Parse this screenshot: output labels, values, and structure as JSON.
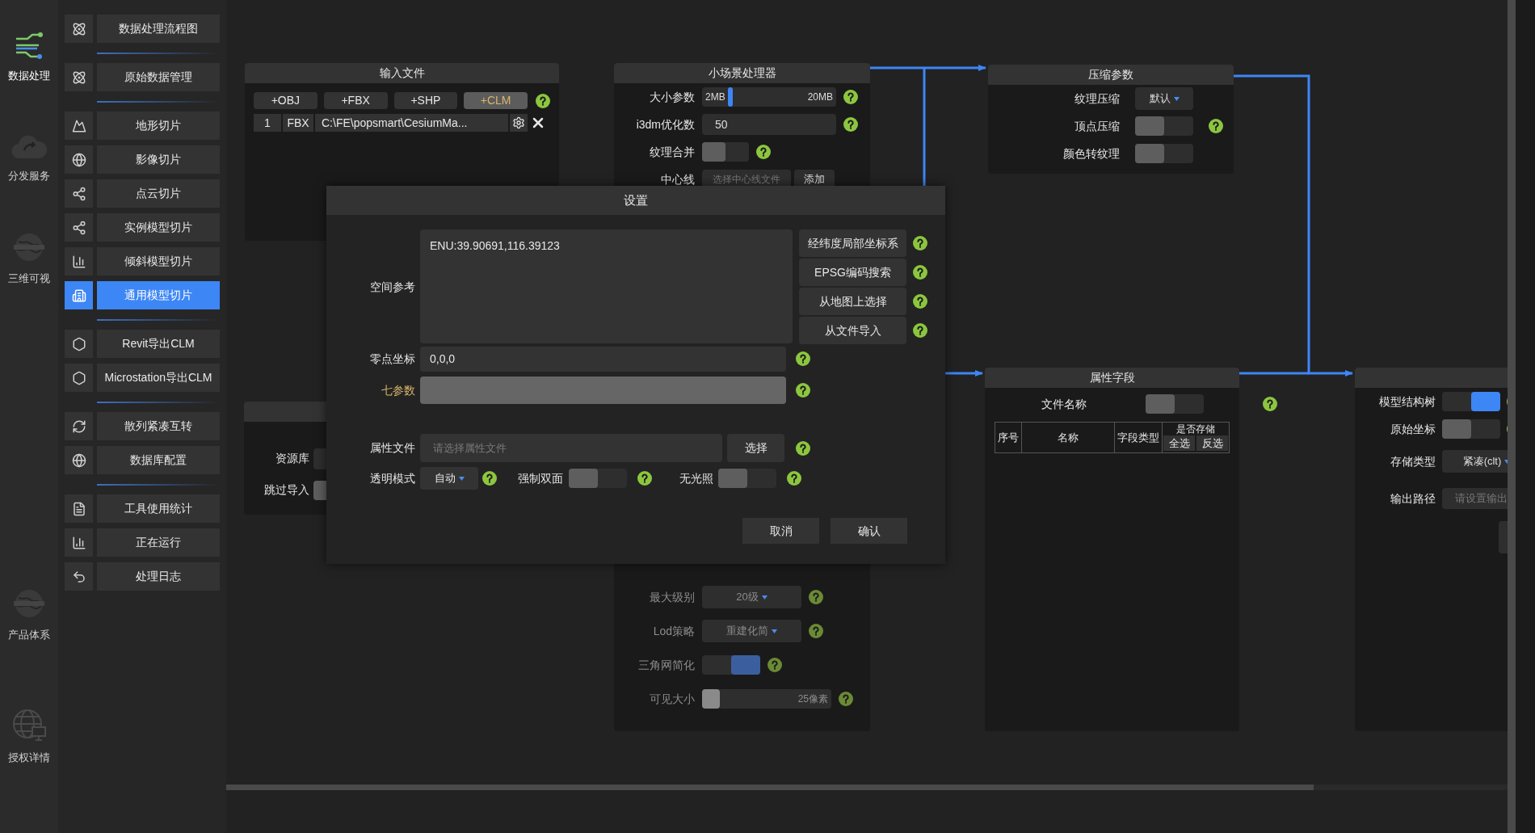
{
  "rail": [
    {
      "label": "数据处理",
      "selected": true
    },
    {
      "label": "分发服务",
      "selected": false
    },
    {
      "label": "三维可视",
      "selected": false
    },
    {
      "label": "产品体系",
      "selected": false
    },
    {
      "label": "授权详情",
      "selected": false
    }
  ],
  "menu": [
    [
      {
        "label": "数据处理流程图",
        "selected": false
      }
    ],
    [
      {
        "label": "原始数据管理",
        "selected": false
      }
    ],
    [
      {
        "label": "地形切片",
        "selected": false
      },
      {
        "label": "影像切片",
        "selected": false
      },
      {
        "label": "点云切片",
        "selected": false
      },
      {
        "label": "实例模型切片",
        "selected": false
      },
      {
        "label": "倾斜模型切片",
        "selected": false
      },
      {
        "label": "通用模型切片",
        "selected": true
      }
    ],
    [
      {
        "label": "Revit导出CLM",
        "selected": false
      },
      {
        "label": "Microstation导出CLM",
        "selected": false
      }
    ],
    [
      {
        "label": "散列紧凑互转",
        "selected": false
      },
      {
        "label": "数据库配置",
        "selected": false
      }
    ],
    [
      {
        "label": "工具使用统计",
        "selected": false
      },
      {
        "label": "正在运行",
        "selected": false
      },
      {
        "label": "处理日志",
        "selected": false
      }
    ]
  ],
  "input_node": {
    "title": "输入文件",
    "file_buttons": [
      {
        "label": "+OBJ",
        "selected": false
      },
      {
        "label": "+FBX",
        "selected": false
      },
      {
        "label": "+SHP",
        "selected": false
      },
      {
        "label": "+CLM",
        "selected": true
      }
    ],
    "files": [
      {
        "index": "1",
        "format": "FBX",
        "path": "C:\\FE\\popsmart\\CesiumMa..."
      }
    ]
  },
  "scene_node": {
    "title": "小场景处理器",
    "upper_rows": [
      {
        "kind": "slider",
        "label": "大小参数",
        "min_label": "2MB",
        "max_label": "20MB",
        "level": 0.2,
        "help": true,
        "disabled": false
      },
      {
        "kind": "input",
        "label": "i3dm优化数",
        "value": "50",
        "help": true,
        "disabled": false
      },
      {
        "kind": "toggle",
        "label": "纹理合并",
        "on": false,
        "help": true,
        "disabled": false
      },
      {
        "kind": "file",
        "label": "中心线",
        "placeholder": "选择中心线文件",
        "button": "添加",
        "help": false,
        "disabled": false
      }
    ],
    "lower_rows": [
      {
        "kind": "dropdown",
        "label": "最大级别",
        "value": "20级",
        "help": true,
        "disabled": true
      },
      {
        "kind": "dropdown",
        "label": "Lod策略",
        "value": "重建化简",
        "help": true,
        "disabled": true
      },
      {
        "kind": "toggle",
        "label": "三角网简化",
        "on": true,
        "help": true,
        "disabled": true
      },
      {
        "kind": "slider",
        "label": "可见大小",
        "max_label": "25像素",
        "level": 0,
        "help": true,
        "disabled": true
      }
    ]
  },
  "compress_node": {
    "title": "压缩参数",
    "rows": [
      {
        "kind": "dropdown",
        "label": "纹理压缩",
        "value": "默认",
        "help": false
      },
      {
        "kind": "toggle",
        "label": "顶点压缩",
        "on": false,
        "help": true
      },
      {
        "kind": "toggle",
        "label": "颜色转纹理",
        "on": false,
        "help": false
      }
    ]
  },
  "resource_node": {
    "rows": [
      {
        "kind": "input",
        "label": "资源库",
        "help": false
      },
      {
        "kind": "toggle",
        "label": "跳过导入",
        "on": false,
        "help": false
      }
    ]
  },
  "attribute_node": {
    "title": "属性字段",
    "rows": [
      {
        "kind": "toggle",
        "label": "文件名称",
        "on": false,
        "help": true
      }
    ],
    "table": {
      "columns": [
        "序号",
        "名称",
        "字段类型",
        "是否存储"
      ],
      "store_actions": [
        "全选",
        "反选"
      ]
    }
  },
  "output_node": {
    "rows": [
      {
        "kind": "toggle",
        "label": "模型结构树",
        "on": true,
        "help": true
      },
      {
        "kind": "toggle",
        "label": "原始坐标",
        "on": false,
        "help": true
      },
      {
        "kind": "dropdown",
        "label": "存储类型",
        "value": "紧凑(clt)",
        "help": false
      },
      {
        "kind": "input",
        "label": "输出路径",
        "placeholder": "请设置输出",
        "help": false
      },
      {
        "kind": "button",
        "help": false
      }
    ]
  },
  "dialog": {
    "title": "设置",
    "spatial_reference": {
      "label": "空间参考",
      "value": "ENU:39.90691,116.39123"
    },
    "crs_buttons": [
      "经纬度局部坐标系",
      "EPSG编码搜索",
      "从地图上选择",
      "从文件导入"
    ],
    "origin": {
      "label": "零点坐标",
      "value": "0,0,0"
    },
    "seven_params": {
      "label": "七参数"
    },
    "attribute_file": {
      "label": "属性文件",
      "placeholder": "请选择属性文件",
      "button": "选择"
    },
    "transparency": {
      "label": "透明模式",
      "value": "自动"
    },
    "double_sided": {
      "label": "强制双面",
      "on": false
    },
    "unlit": {
      "label": "无光照",
      "on": false
    },
    "buttons": [
      "取消",
      "确认"
    ]
  }
}
